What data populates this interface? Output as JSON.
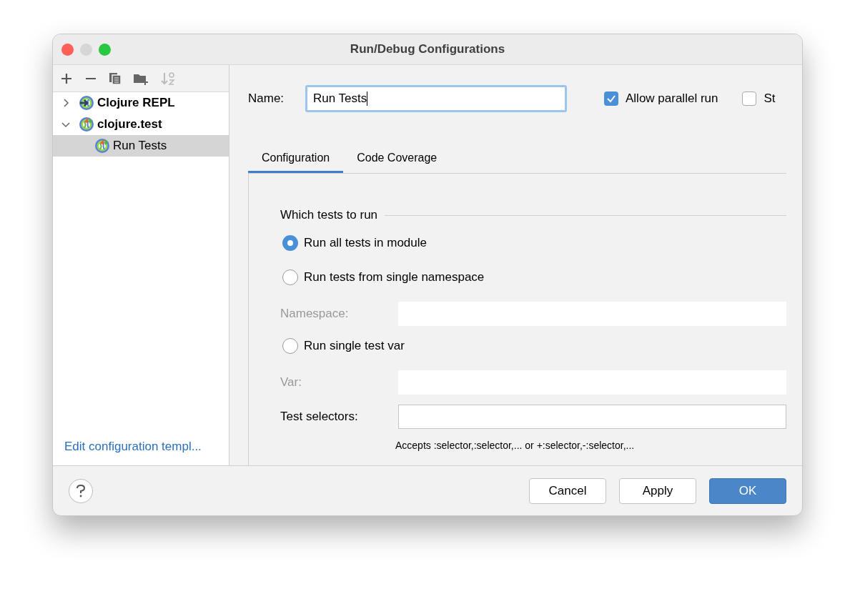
{
  "window": {
    "title": "Run/Debug Configurations"
  },
  "tree": [
    {
      "label": "Clojure REPL",
      "kind": "repl",
      "expanded": false,
      "selected": false
    },
    {
      "label": "clojure.test",
      "kind": "test",
      "expanded": true,
      "selected": false,
      "children": [
        {
          "label": "Run Tests",
          "kind": "test",
          "selected": true
        }
      ]
    }
  ],
  "template_link": "Edit configuration templ...",
  "name_field": {
    "label": "Name:",
    "value": "Run Tests"
  },
  "options": [
    {
      "label": "Allow parallel run",
      "checked": true
    },
    {
      "label": "St",
      "checked": false
    }
  ],
  "tabs": [
    {
      "label": "Configuration",
      "selected": true
    },
    {
      "label": "Code Coverage",
      "selected": false
    }
  ],
  "section_title": "Which tests to run",
  "items": [
    {
      "kind": "radio",
      "label": "Run all tests in module",
      "selected": true
    },
    {
      "kind": "radio",
      "label": "Run tests from single namespace",
      "selected": false
    },
    {
      "kind": "field",
      "label": "Namespace:",
      "disabled": true
    },
    {
      "kind": "radio",
      "label": "Run single test var",
      "selected": false
    },
    {
      "kind": "field",
      "label": "Var:",
      "disabled": true
    },
    {
      "kind": "field",
      "label": "Test selectors:",
      "disabled": false
    },
    {
      "kind": "hint",
      "label": "Accepts :selector,:selector,... or +:selector,-:selector,..."
    }
  ],
  "buttons": [
    {
      "label": "Cancel",
      "primary": false
    },
    {
      "label": "Apply",
      "primary": false
    },
    {
      "label": "OK",
      "primary": true
    }
  ]
}
